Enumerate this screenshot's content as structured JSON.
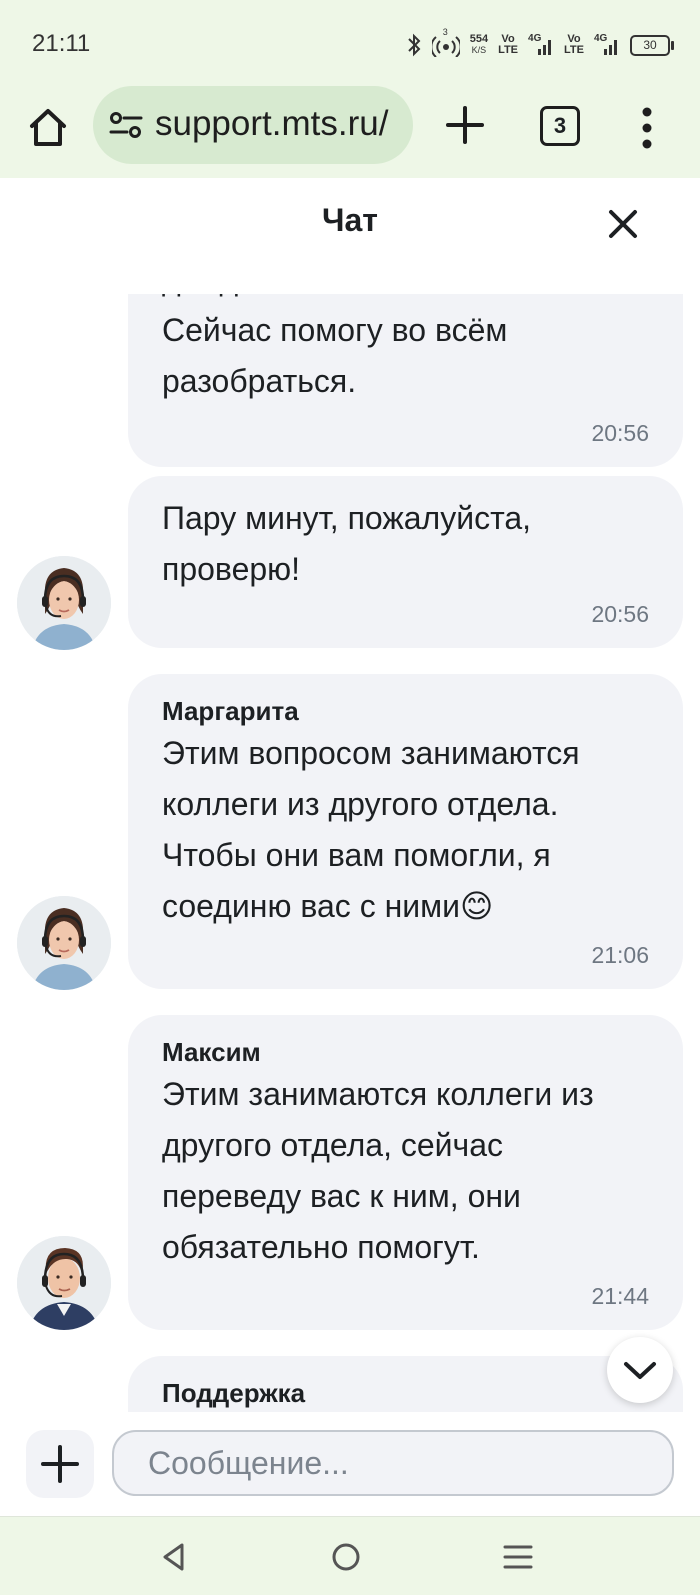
{
  "status_bar": {
    "time": "21:11",
    "speed_value": "554",
    "speed_unit": "K/S",
    "volte1_top": "Vo",
    "volte1_bottom": "LTE",
    "net1": "4G",
    "volte2_top": "Vo",
    "volte2_bottom": "LTE",
    "net2": "4G",
    "battery": "30",
    "hotspot_count": "3"
  },
  "browser": {
    "url": "support.mts.ru/",
    "tab_count": "3"
  },
  "chat": {
    "title": "Чат",
    "messages": [
      {
        "text_partial": "дождались ответа.",
        "text": "Сейчас помогу во всём разобраться.",
        "time": "20:56"
      },
      {
        "text": "Пару минут, пожалуйста, проверю!",
        "time": "20:56"
      },
      {
        "sender": "Маргарита",
        "text": "Этим вопросом занимаются коллеги из другого отдела. Чтобы они вам помогли, я соединю вас с ними😊",
        "time": "21:06"
      },
      {
        "sender": "Максим",
        "text": "Этим занимаются коллеги из другого отдела, сейчас переведу вас к ним, они обязательно помогут.",
        "time": "21:44"
      },
      {
        "sender": "Поддержка"
      }
    ]
  },
  "composer": {
    "placeholder": "Сообщение..."
  },
  "colors": {
    "bubble_bg": "#f2f3f7",
    "chrome_bg": "#eef7e7",
    "url_pill_bg": "#d7ead0",
    "text": "#1d2023",
    "muted": "#6e7782"
  }
}
